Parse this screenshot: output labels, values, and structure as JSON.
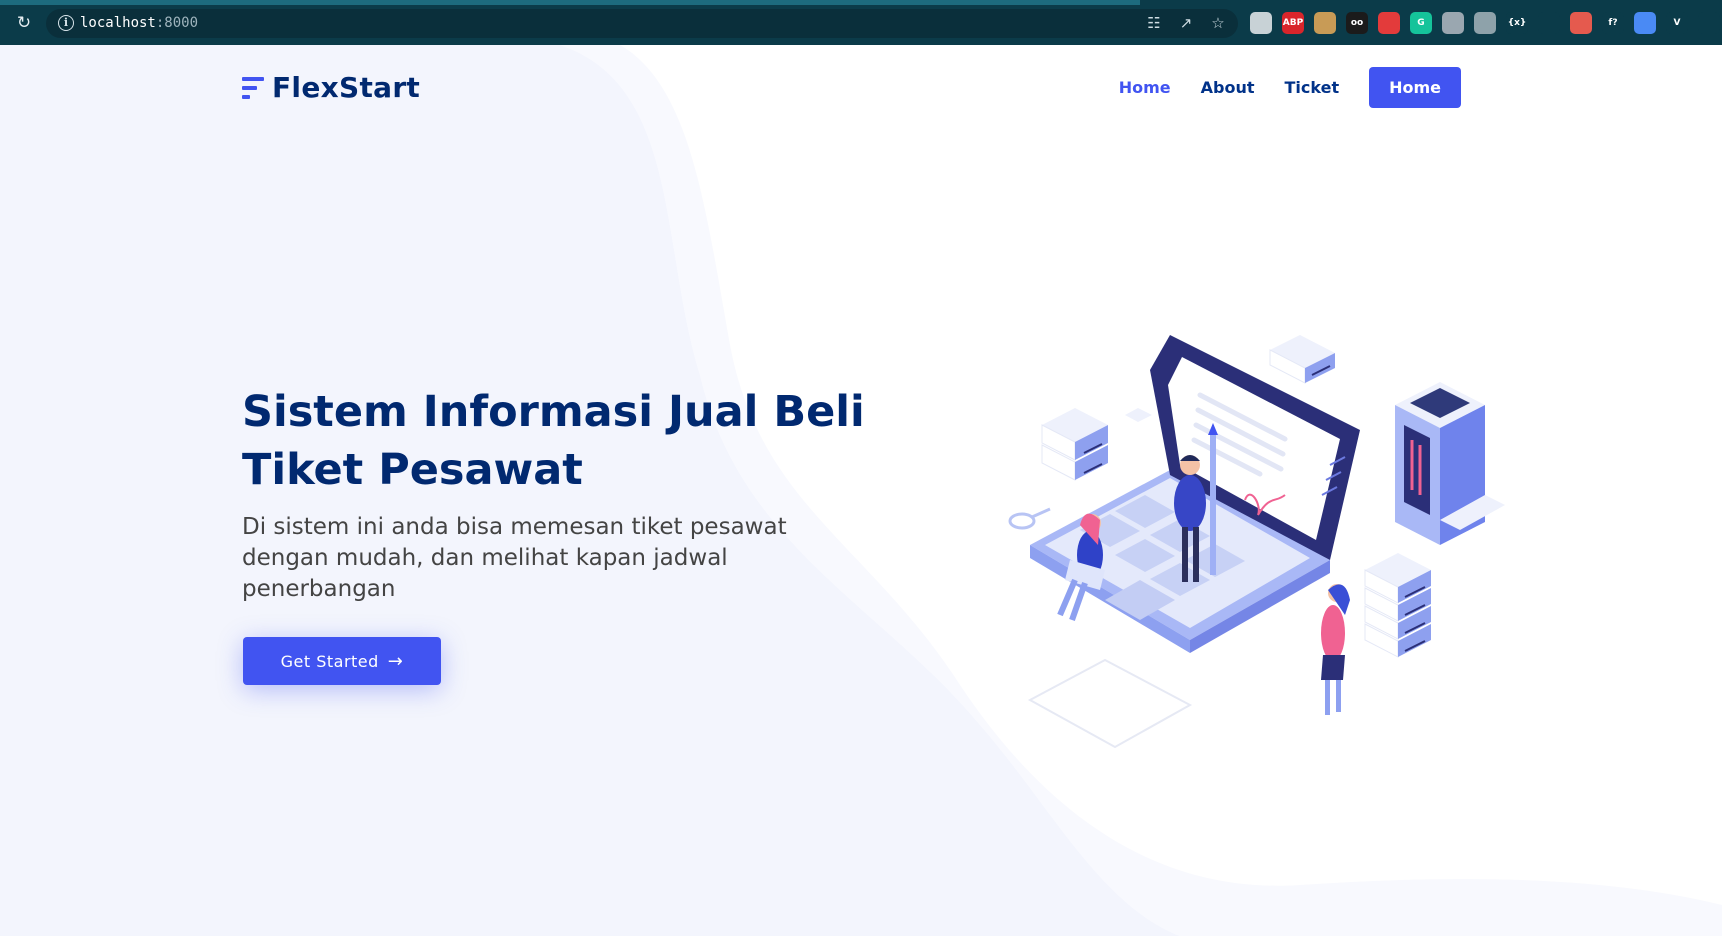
{
  "browser": {
    "url_host": "localhost",
    "url_port": ":8000",
    "omnibox_icons": [
      "translate-icon",
      "share-icon",
      "star-icon"
    ],
    "extensions": [
      {
        "name": "extension-gray-icon",
        "color": "#c8d2d6",
        "label": ""
      },
      {
        "name": "adblock-plus-icon",
        "color": "#d9252b",
        "label": "ABP"
      },
      {
        "name": "cookie-icon",
        "color": "#c89b56",
        "label": ""
      },
      {
        "name": "extension-glasses-icon",
        "color": "#1b1b1b",
        "label": "oo"
      },
      {
        "name": "extension-red-dot-icon",
        "color": "#e33b3b",
        "label": ""
      },
      {
        "name": "grammarly-icon",
        "color": "#15c39a",
        "label": "G"
      },
      {
        "name": "extension-pencil-icon",
        "color": "#9aa7b0",
        "label": ""
      },
      {
        "name": "settings-gear-icon",
        "color": "#8ea2aa",
        "label": ""
      },
      {
        "name": "extension-braces-icon",
        "color": "#0b3b49",
        "label": "{x}"
      },
      {
        "name": "react-devtools-icon",
        "color": "#0b3b49",
        "label": ""
      },
      {
        "name": "extension-pdf-icon",
        "color": "#e55a4e",
        "label": ""
      },
      {
        "name": "font-identifier-icon",
        "color": "#0b3b49",
        "label": "f?"
      },
      {
        "name": "google-translate-icon",
        "color": "#4a8af4",
        "label": ""
      },
      {
        "name": "vue-devtools-icon",
        "color": "#0b3b49",
        "label": "V"
      },
      {
        "name": "extensions-puzzle-icon",
        "color": "#0b3b49",
        "label": ""
      }
    ]
  },
  "header": {
    "logo_text": "FlexStart",
    "nav": {
      "home": "Home",
      "about": "About",
      "ticket": "Ticket",
      "button": "Home"
    }
  },
  "hero": {
    "title": "Sistem Informasi Jual Beli Tiket Pesawat",
    "subtitle": "Di sistem ini anda bisa memesan tiket pesawat dengan mudah, dan melihat kapan jadwal penerbangan",
    "cta_label": "Get Started",
    "cta_icon": "arrow-right-icon"
  },
  "colors": {
    "primary": "#4154f1",
    "heading": "#012970",
    "text": "#444444",
    "background_tint": "#f3f5fd"
  }
}
